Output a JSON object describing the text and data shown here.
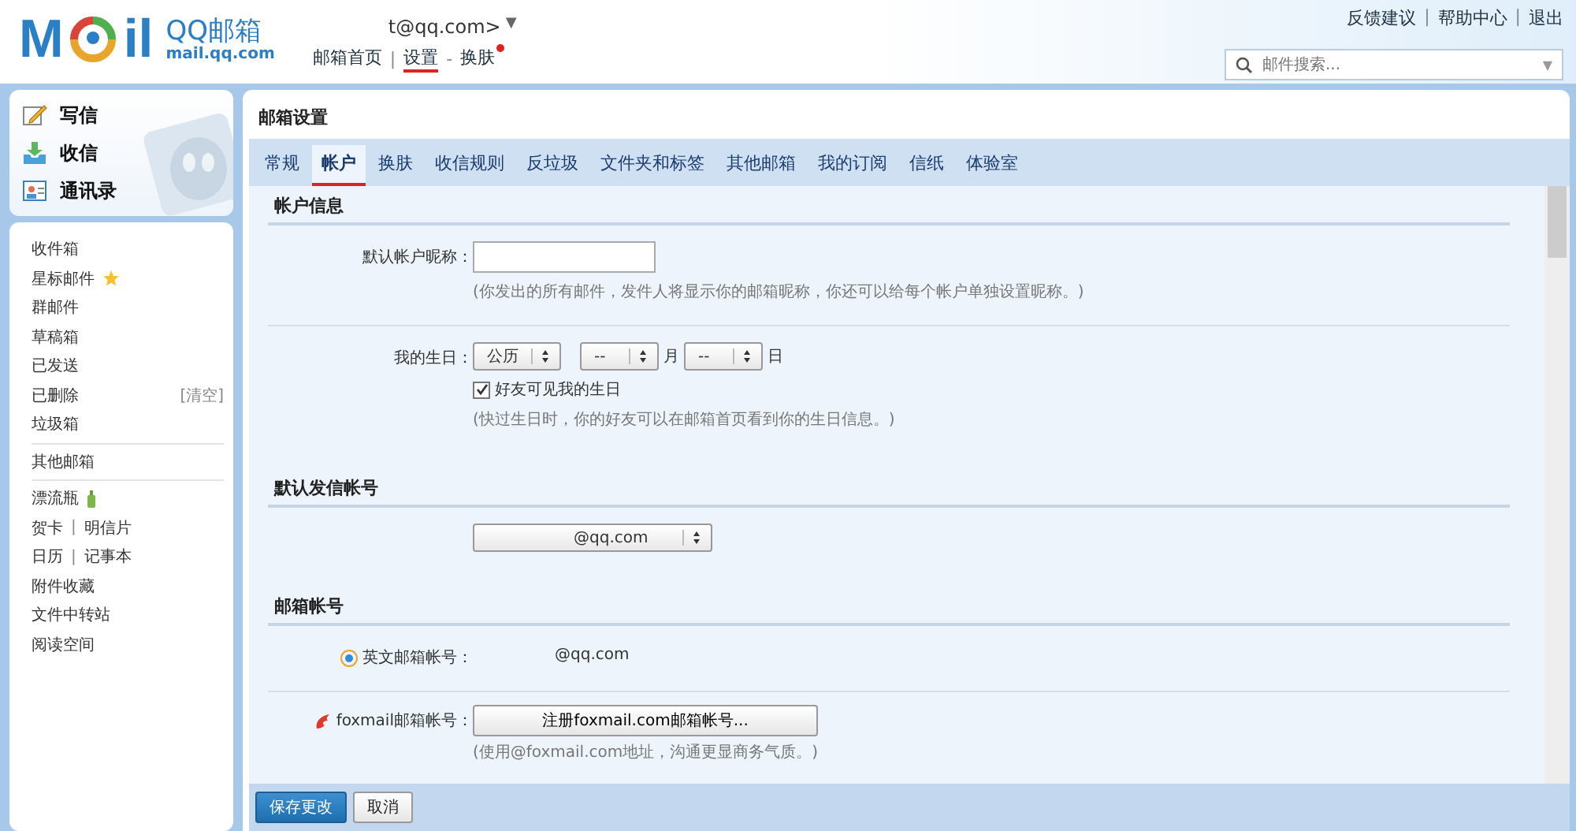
{
  "logo": {
    "left": "M",
    "right": "il",
    "name": "QQ邮箱",
    "domain": "mail.qq.com"
  },
  "account": {
    "address": "t@qq.com>",
    "caret": "▼"
  },
  "nav": [
    {
      "label": "邮箱首页",
      "marked": false,
      "dot": false
    },
    {
      "label": "设置",
      "marked": true,
      "dot": false
    },
    {
      "label": "换肤",
      "marked": false,
      "dot": true
    }
  ],
  "nav_separators": [
    "|",
    "-"
  ],
  "top_links": [
    "反馈建议",
    "帮助中心",
    "退出"
  ],
  "top_link_separator": "|",
  "search": {
    "placeholder": "邮件搜索...",
    "caret": "▼"
  },
  "quick_actions": [
    {
      "kind": "write",
      "label": "写信"
    },
    {
      "kind": "inbox",
      "label": "收信"
    },
    {
      "kind": "contacts",
      "label": "通讯录"
    }
  ],
  "folder_groups": [
    [
      {
        "kind": "plain",
        "label": "收件箱"
      },
      {
        "kind": "starred",
        "label": "星标邮件"
      },
      {
        "kind": "plain",
        "label": "群邮件"
      },
      {
        "kind": "plain",
        "label": "草稿箱"
      },
      {
        "kind": "plain",
        "label": "已发送"
      },
      {
        "kind": "plain",
        "label": "已删除",
        "action": "[清空]"
      },
      {
        "kind": "plain",
        "label": "垃圾箱"
      }
    ],
    [
      {
        "kind": "plain",
        "label": "其他邮箱"
      }
    ],
    [
      {
        "kind": "bottle",
        "label": "漂流瓶"
      },
      {
        "kind": "plain",
        "label": "贺卡",
        "second": "明信片"
      },
      {
        "kind": "plain",
        "label": "日历",
        "second": "记事本"
      },
      {
        "kind": "plain",
        "label": "附件收藏"
      },
      {
        "kind": "plain",
        "label": "文件中转站"
      },
      {
        "kind": "plain",
        "label": "阅读空间"
      }
    ]
  ],
  "folder_separator": "|",
  "page_title": "邮箱设置",
  "tabs": [
    {
      "label": "常规",
      "selected": false
    },
    {
      "label": "帐户",
      "selected": true
    },
    {
      "label": "换肤",
      "selected": false
    },
    {
      "label": "收信规则",
      "selected": false
    },
    {
      "label": "反垃圾",
      "selected": false
    },
    {
      "label": "文件夹和标签",
      "selected": false
    },
    {
      "label": "其他邮箱",
      "selected": false
    },
    {
      "label": "我的订阅",
      "selected": false
    },
    {
      "label": "信纸",
      "selected": false
    },
    {
      "label": "体验室",
      "selected": false
    }
  ],
  "account_info": {
    "title": "帐户信息",
    "nickname_label": "默认帐户昵称：",
    "nickname_hint": "(你发出的所有邮件，发件人将显示你的邮箱昵称，你还可以给每个帐户单独设置昵称。)",
    "birthday_label": "我的生日：",
    "calendar": "公历",
    "month": "--",
    "month_unit": "月",
    "day": "--",
    "day_unit": "日",
    "show_birthday": {
      "label": "好友可见我的生日",
      "checked": true
    },
    "birthday_hint": "(快过生日时，你的好友可以在邮箱首页看到你的生日信息。)"
  },
  "default_sender": {
    "title": "默认发信帐号",
    "value": "@qq.com"
  },
  "mail_accounts": {
    "title": "邮箱帐号",
    "english_label": "英文邮箱帐号：",
    "english_value": "@qq.com",
    "foxmail_label": "foxmail邮箱帐号：",
    "foxmail_button": "注册foxmail.com邮箱帐号...",
    "foxmail_hint": "(使用@foxmail.com地址，沟通更显商务气质。)"
  },
  "footer_buttons": [
    {
      "label": "保存更改",
      "primary": true
    },
    {
      "label": "取消",
      "primary": false
    }
  ]
}
